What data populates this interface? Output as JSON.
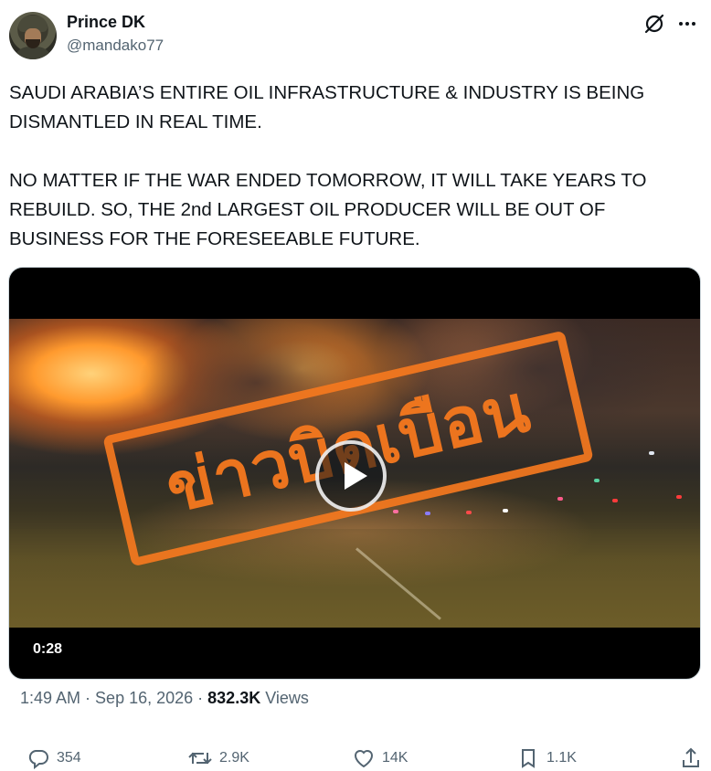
{
  "author": {
    "display_name": "Prince DK",
    "handle": "@mandako77"
  },
  "header_icons": {
    "grok": "grok-icon",
    "more": "more-icon"
  },
  "tweet": {
    "paragraph_1": "SAUDI ARABIA’S ENTIRE OIL INFRASTRUCTURE & INDUSTRY IS BEING DISMANTLED IN REAL TIME.",
    "paragraph_2": "NO MATTER IF THE WAR ENDED TOMORROW, IT WILL TAKE YEARS TO REBUILD. SO, THE 2nd LARGEST OIL PRODUCER WILL BE OUT OF BUSINESS FOR THE FORESEEABLE FUTURE."
  },
  "media": {
    "type": "video",
    "stamp_text": "ข่าวบิดเบือน",
    "duration": "0:28",
    "stamp_color": "#f5781e"
  },
  "meta": {
    "time": "1:49 AM",
    "separator": " · ",
    "date": "Sep 16, 2026",
    "views_count": "832.3K",
    "views_label": "Views"
  },
  "actions": {
    "replies": "354",
    "reposts": "2.9K",
    "likes": "14K",
    "bookmarks": "1.1K"
  },
  "colors": {
    "text_primary": "#0f1419",
    "text_secondary": "#536471",
    "border": "#cfd9de"
  }
}
